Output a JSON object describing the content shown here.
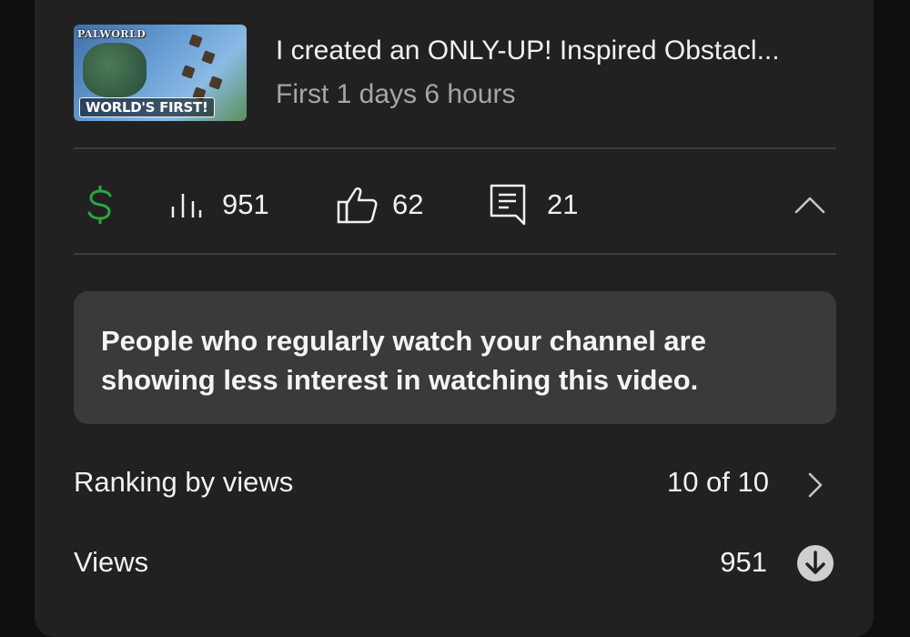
{
  "video": {
    "title": "I created an ONLY-UP! Inspired Obstacl...",
    "subtitle": "First 1 days 6 hours",
    "thumbnail": {
      "logo_text": "PALWORLD",
      "badge_text": "WORLD'S FIRST!"
    }
  },
  "stats": {
    "monetization_icon": "dollar-icon",
    "monetization_color": "#2ba640",
    "views_icon": "bar-chart-icon",
    "views": "951",
    "likes_icon": "thumbs-up-icon",
    "likes": "62",
    "comments_icon": "comment-icon",
    "comments": "21",
    "collapse_icon": "chevron-up-icon"
  },
  "notice": {
    "text": "People who regularly watch your channel are showing less interest in watching this video."
  },
  "ranking": {
    "label": "Ranking by views",
    "value": "10 of 10",
    "icon": "chevron-right-icon"
  },
  "views_row": {
    "label": "Views",
    "value": "951",
    "icon": "arrow-down-circle-icon"
  }
}
